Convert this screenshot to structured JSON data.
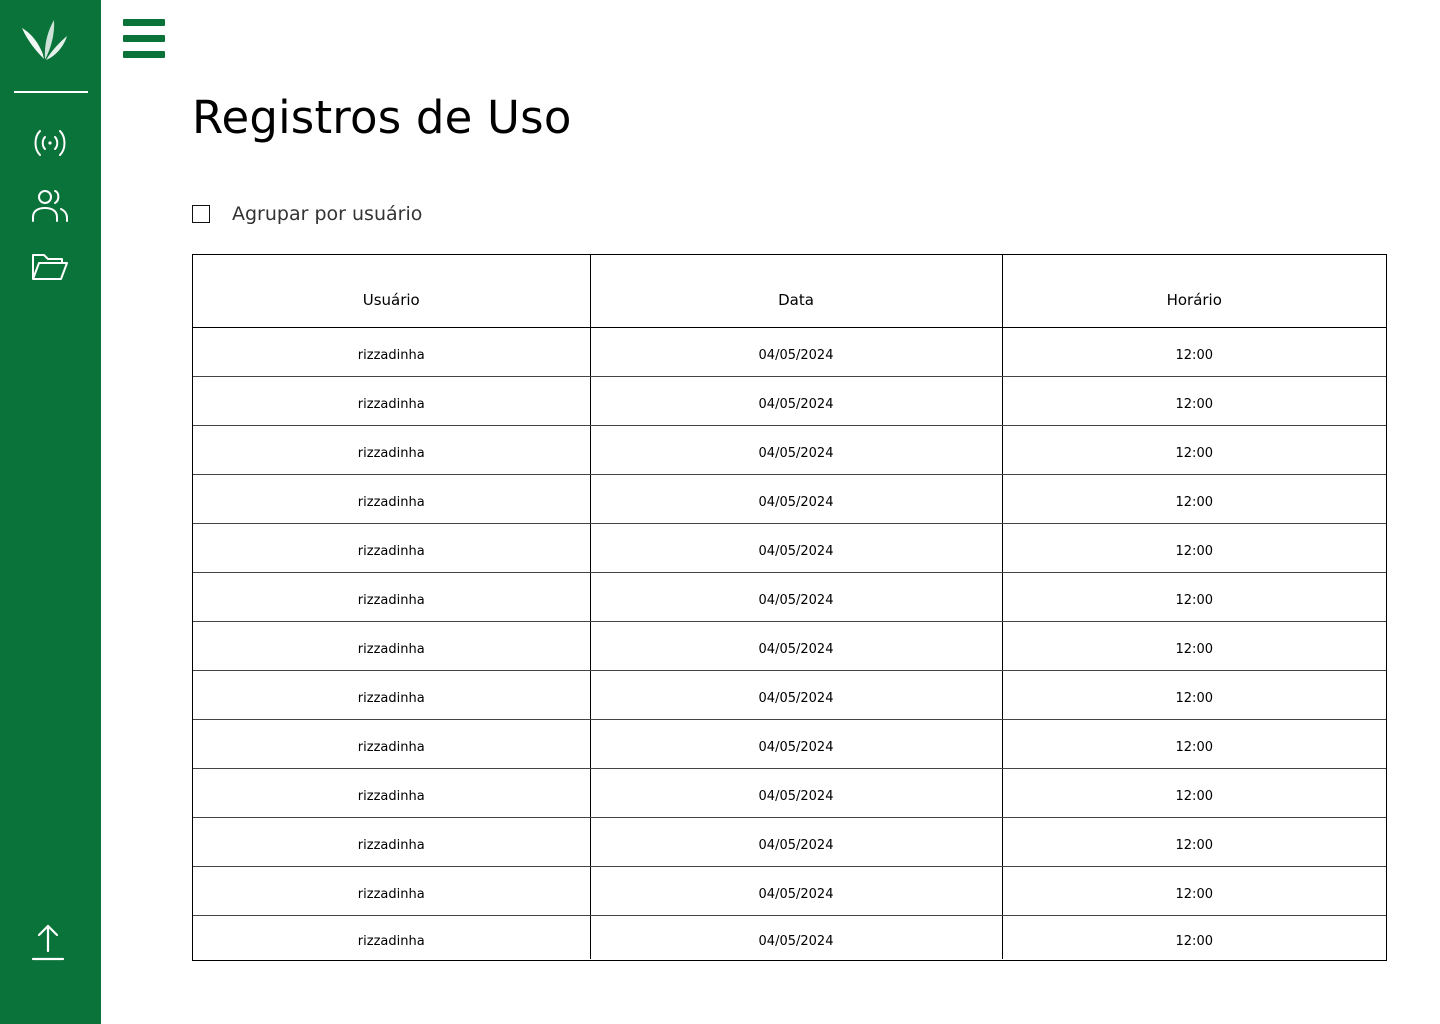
{
  "colors": {
    "brand_green": "#0a7339",
    "background": "#ffffff"
  },
  "sidebar": {
    "logo": "leaf-logo",
    "items": [
      {
        "icon": "broadcast-icon"
      },
      {
        "icon": "users-icon"
      },
      {
        "icon": "folder-open-icon"
      }
    ],
    "footer_icon": "upload-icon"
  },
  "header": {
    "menu_icon": "hamburger-menu-icon"
  },
  "page": {
    "title": "Registros de Uso"
  },
  "filters": {
    "group_by_user_label": "Agrupar por usuário",
    "group_by_user_checked": false
  },
  "table": {
    "columns": [
      "Usuário",
      "Data",
      "Horário"
    ],
    "rows": [
      [
        "rizzadinha",
        "04/05/2024",
        "12:00"
      ],
      [
        "rizzadinha",
        "04/05/2024",
        "12:00"
      ],
      [
        "rizzadinha",
        "04/05/2024",
        "12:00"
      ],
      [
        "rizzadinha",
        "04/05/2024",
        "12:00"
      ],
      [
        "rizzadinha",
        "04/05/2024",
        "12:00"
      ],
      [
        "rizzadinha",
        "04/05/2024",
        "12:00"
      ],
      [
        "rizzadinha",
        "04/05/2024",
        "12:00"
      ],
      [
        "rizzadinha",
        "04/05/2024",
        "12:00"
      ],
      [
        "rizzadinha",
        "04/05/2024",
        "12:00"
      ],
      [
        "rizzadinha",
        "04/05/2024",
        "12:00"
      ],
      [
        "rizzadinha",
        "04/05/2024",
        "12:00"
      ],
      [
        "rizzadinha",
        "04/05/2024",
        "12:00"
      ],
      [
        "rizzadinha",
        "04/05/2024",
        "12:00"
      ]
    ]
  }
}
